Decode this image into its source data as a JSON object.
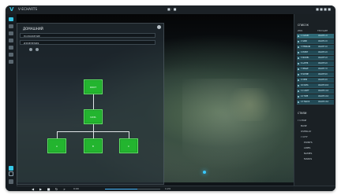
{
  "topbar": {
    "logo": "V",
    "title": "V-ECHARTS",
    "center": "■ · ■",
    "right": "■ ■ ■ ■"
  },
  "graph": {
    "title": "ДОМАШНИЙ",
    "field1": "ПОЛОЖЕНИЕ",
    "field2": "ИЗМЕНЕНИЯ",
    "node_root": "ROOT",
    "node_mid": "DATA",
    "node_left": "A",
    "node_center": "B",
    "node_right": "C"
  },
  "right_panel": {
    "section1": "СПИСОК",
    "headers": [
      "ИМЯ",
      "ТЕКУЩЕЕ"
    ],
    "rows": [
      {
        "id": "1 CLOUD",
        "value": "VALUE 1.0"
      },
      {
        "id": "2 GRID",
        "value": "VALUE 2.0"
      },
      {
        "id": "3 TERRAIN",
        "value": "VALUE 3.0"
      },
      {
        "id": "4 POINT",
        "value": "VALUE 4.0"
      },
      {
        "id": "5 MODEL",
        "value": "VALUE 5.0"
      },
      {
        "id": "6 LAYER",
        "value": "VALUE 6.0"
      },
      {
        "id": "7 IMAGE",
        "value": "VALUE 7.0"
      },
      {
        "id": "8 SCENE",
        "value": "VALUE 8.0"
      },
      {
        "id": "9 VIEW",
        "value": "VALUE 9.0"
      },
      {
        "id": "10 DATA",
        "value": "VALUE 10.0"
      },
      {
        "id": "11 LIGHT",
        "value": "VALUE 11.0"
      },
      {
        "id": "12 TIME",
        "value": "VALUE 12.0"
      },
      {
        "id": "13 TRACK",
        "value": "VALUE 13.0"
      }
    ],
    "section2": "СТИЛИ",
    "tree": [
      "СЛОИ",
      "BASE",
      "OVERLAY",
      "CITY",
      "POINTS",
      "LINES",
      "NAMES",
      "MARKS"
    ]
  },
  "bottom": {
    "time_left": "0:00",
    "time_right": "1:24",
    "progress": 0.58
  },
  "colors": {
    "accent": "#35c6e5",
    "node": "#23b52f",
    "panel": "#263038",
    "map_dark": "#050607",
    "map_land": "#556f52"
  }
}
